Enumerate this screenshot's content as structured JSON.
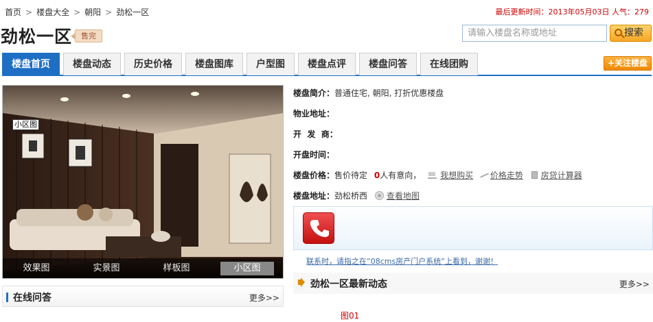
{
  "breadcrumb": [
    "首页",
    "楼盘大全",
    "朝阳",
    "劲松一区"
  ],
  "update": {
    "label": "最后更新时间：",
    "date": "2013年05月03日",
    "popularity_label": "人气：",
    "popularity": "279"
  },
  "title": "劲松一区",
  "status_badge": "售完",
  "search": {
    "placeholder": "请输入楼盘名称或地址",
    "button": "搜索"
  },
  "tabs": [
    "楼盘首页",
    "楼盘动态",
    "历史价格",
    "楼盘图库",
    "户型图",
    "楼盘点评",
    "楼盘问答",
    "在线团购"
  ],
  "follow_button": "+关注楼盘",
  "photo": {
    "label": "小区图",
    "tabs": [
      "效果图",
      "实景图",
      "样板图",
      "小区图"
    ]
  },
  "info": {
    "intro_label": "楼盘简介：",
    "intro_value": "普通住宅, 朝阳, 打折优惠楼盘",
    "address_label": "物业地址：",
    "developer_label": "开  发  商：",
    "opening_label": "开盘时间：",
    "price_label": "楼盘价格：",
    "price_value": "售价待定",
    "intent_count": "0",
    "intent_suffix": "人有意向，",
    "want_buy": "我想购买",
    "price_trend": "价格走势",
    "loan_calc": "房贷计算器",
    "location_label": "楼盘地址：",
    "location_value": "劲松桥西",
    "view_map": "查看地图"
  },
  "notice": "联系时，请指之在“08cms房产门户系统”上看到，谢谢！",
  "left_section": {
    "title": "在线问答",
    "more": "更多>>"
  },
  "right_section": {
    "title": "劲松一区最新动态",
    "more": "更多>>"
  },
  "caption": "图01",
  "colors": {
    "accent": "#1e6fc4",
    "highlight": "#cc0000",
    "follow": "#f08a00"
  }
}
